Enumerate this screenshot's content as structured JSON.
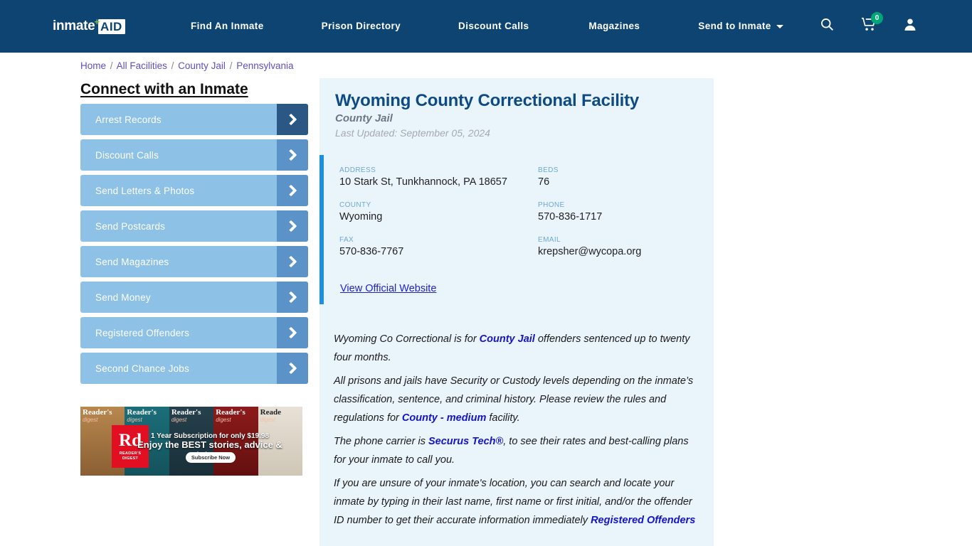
{
  "header": {
    "logo": {
      "word": "inmate",
      "plus": "+",
      "badge": "AID"
    },
    "nav": [
      {
        "label": "Find An Inmate"
      },
      {
        "label": "Prison Directory"
      },
      {
        "label": "Discount Calls"
      },
      {
        "label": "Magazines"
      },
      {
        "label": "Send to Inmate"
      }
    ],
    "icons": {
      "search": "search-icon",
      "cart": "cart-icon",
      "cart_count": "0",
      "account": "user-icon"
    },
    "bg_color": "#0e4472",
    "badge_color": "#00a878"
  },
  "breadcrumb": {
    "items": [
      "Home",
      "All Facilities",
      "County Jail",
      "Pennsylvania"
    ],
    "separator": "/"
  },
  "sidebar": {
    "title": "Connect with an Inmate",
    "items": [
      {
        "label": "Arrest Records",
        "active": true
      },
      {
        "label": "Discount Calls",
        "active": false
      },
      {
        "label": "Send Letters & Photos",
        "active": false
      },
      {
        "label": "Send Postcards",
        "active": false
      },
      {
        "label": "Send Magazines",
        "active": false
      },
      {
        "label": "Send Money",
        "active": false
      },
      {
        "label": "Registered Offenders",
        "active": false
      },
      {
        "label": "Second Chance Jobs",
        "active": false
      }
    ],
    "button_color": "#8ec1e6",
    "arrow_color": "#5b93c8",
    "arrow_active_color": "#2a5783"
  },
  "ad": {
    "brand": "Rd",
    "brand_sub": "READER'S DIGEST",
    "line1": "1 Year Subscription for only $19.98",
    "line2": "Enjoy the BEST stories, advice & jokes!",
    "cta": "Subscribe Now",
    "covers": [
      {
        "title": "Reader's",
        "sub": "digest"
      },
      {
        "title": "Reader's",
        "sub": "digest"
      },
      {
        "title": "Reader's",
        "sub": "digest"
      },
      {
        "title": "Reader's",
        "sub": "digest"
      },
      {
        "title": "Reade",
        "sub": "digest"
      }
    ]
  },
  "facility": {
    "name": "Wyoming County Correctional Facility",
    "type": "County Jail",
    "last_updated": "Last Updated: September 05, 2024",
    "accent_color": "#1a8fe3",
    "fields": [
      {
        "label": "ADDRESS",
        "value": "10 Stark St, Tunkhannock, PA 18657"
      },
      {
        "label": "BEDS",
        "value": "76"
      },
      {
        "label": "COUNTY",
        "value": "Wyoming"
      },
      {
        "label": "PHONE",
        "value": "570-836-1717"
      },
      {
        "label": "FAX",
        "value": "570-836-7767"
      },
      {
        "label": "EMAIL",
        "value": "krepsher@wycopa.org"
      }
    ],
    "official_link": "View Official Website"
  },
  "body": {
    "p1_a": "Wyoming Co Correctional is for ",
    "p1_link": "County Jail",
    "p1_b": " offenders sentenced up to twenty four months.",
    "p2_a": "All prisons and jails have Security or Custody levels depending on the inmate’s classification, sentence, and criminal history. Please review the rules and regulations for ",
    "p2_link": "County - medium",
    "p2_b": " facility.",
    "p3_a": "The phone carrier is ",
    "p3_link": "Securus Tech®",
    "p3_b": ", to see their rates and best-calling plans for your inmate to call you.",
    "p4_a": "If you are unsure of your inmate's location, you can search and locate your inmate by typing in their last name, first name or first initial, and/or the offender ID number to get their accurate information immediately ",
    "p4_link": "Registered Offenders"
  }
}
